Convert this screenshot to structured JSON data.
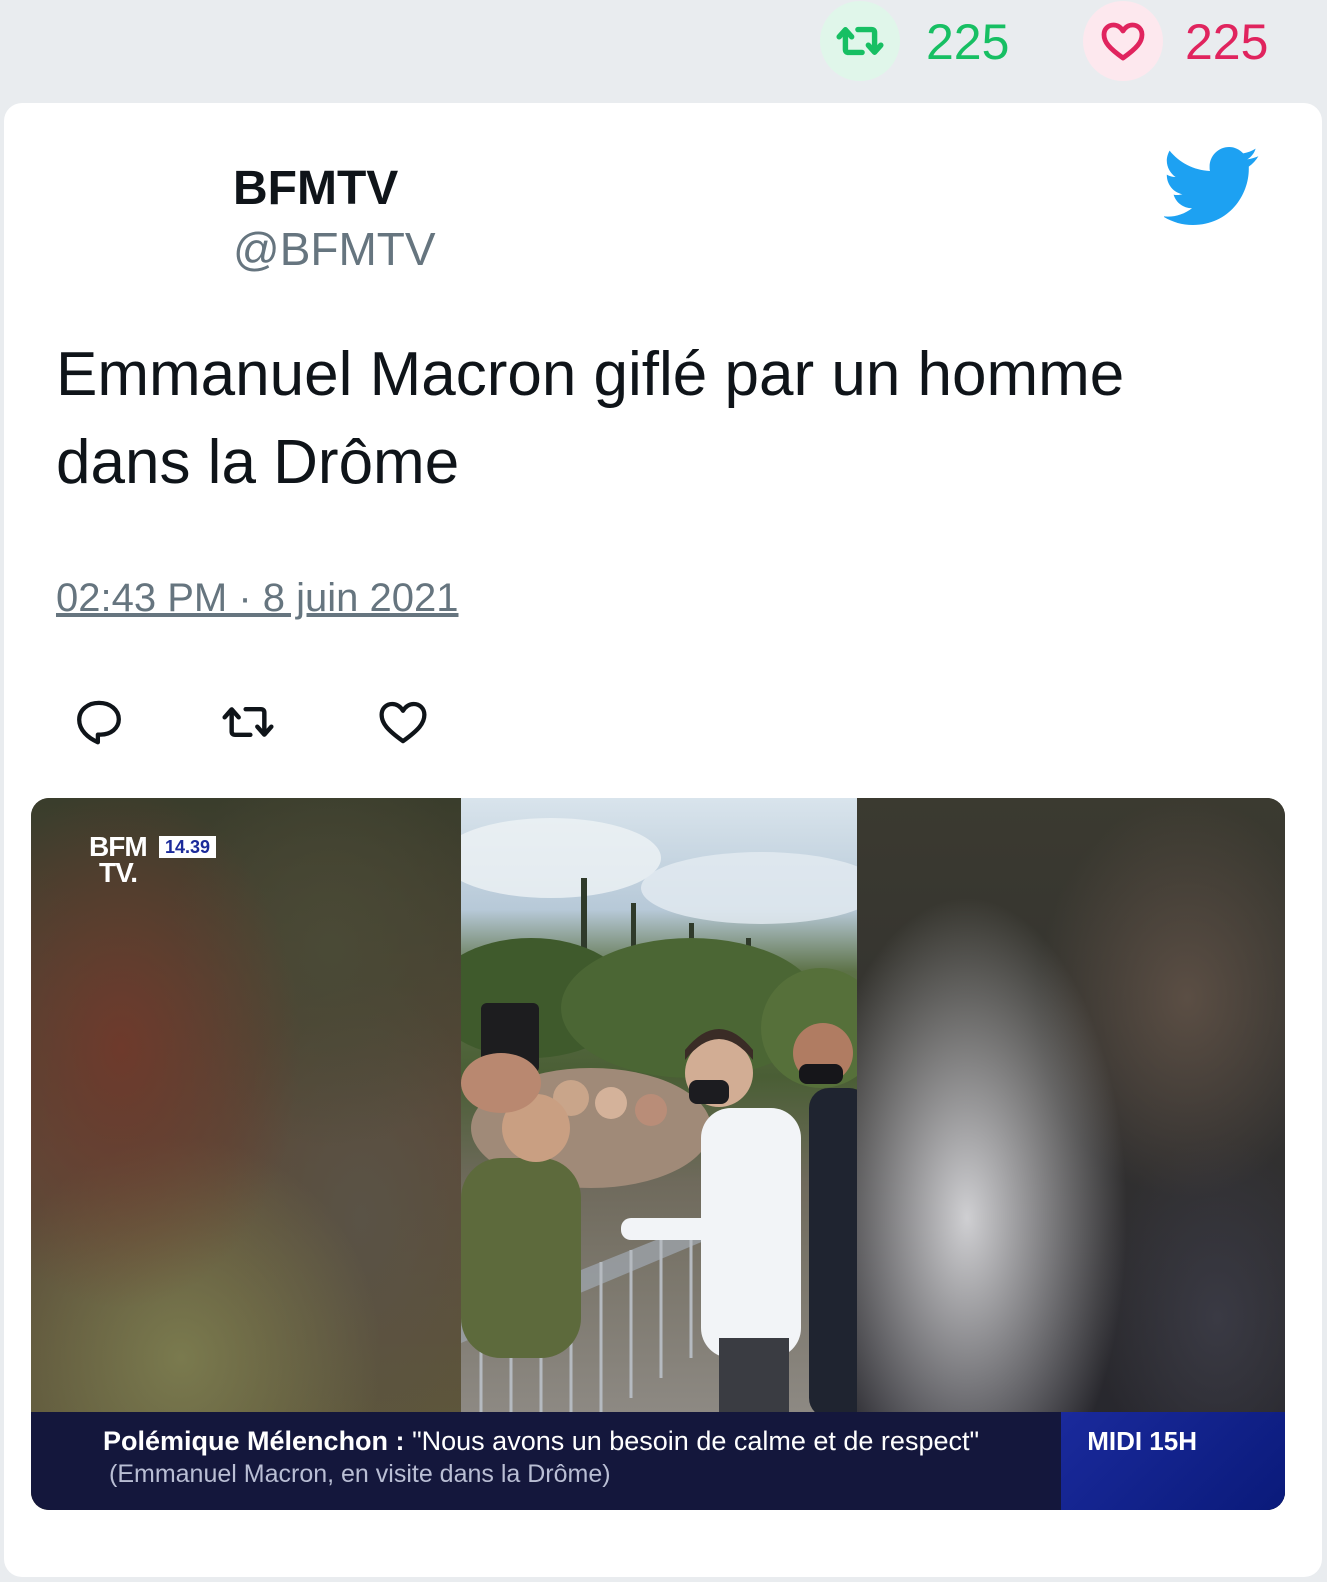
{
  "stats": {
    "retweets": "225",
    "likes": "225",
    "retweet_color": "#17bf63",
    "like_color": "#e0245e"
  },
  "tweet": {
    "display_name": "BFMTV",
    "handle": "@BFMTV",
    "text": "Emmanuel Macron giflé par un homme dans la Drôme",
    "timestamp": "02:43 PM · 8 juin 2021",
    "bird_color": "#1da1f2"
  },
  "actions": {
    "reply_icon": "reply-icon",
    "retweet_icon": "retweet-icon",
    "like_icon": "heart-icon"
  },
  "video": {
    "logo_line1": "BFM",
    "logo_line2": "TV.",
    "clock": "14.39",
    "headline_label": "Polémique Mélenchon :",
    "headline_quote": "\"Nous avons un besoin de calme et de respect\"",
    "headline_sub": "(Emmanuel Macron, en visite dans la Drôme)",
    "show_name": "MIDI 15H"
  }
}
